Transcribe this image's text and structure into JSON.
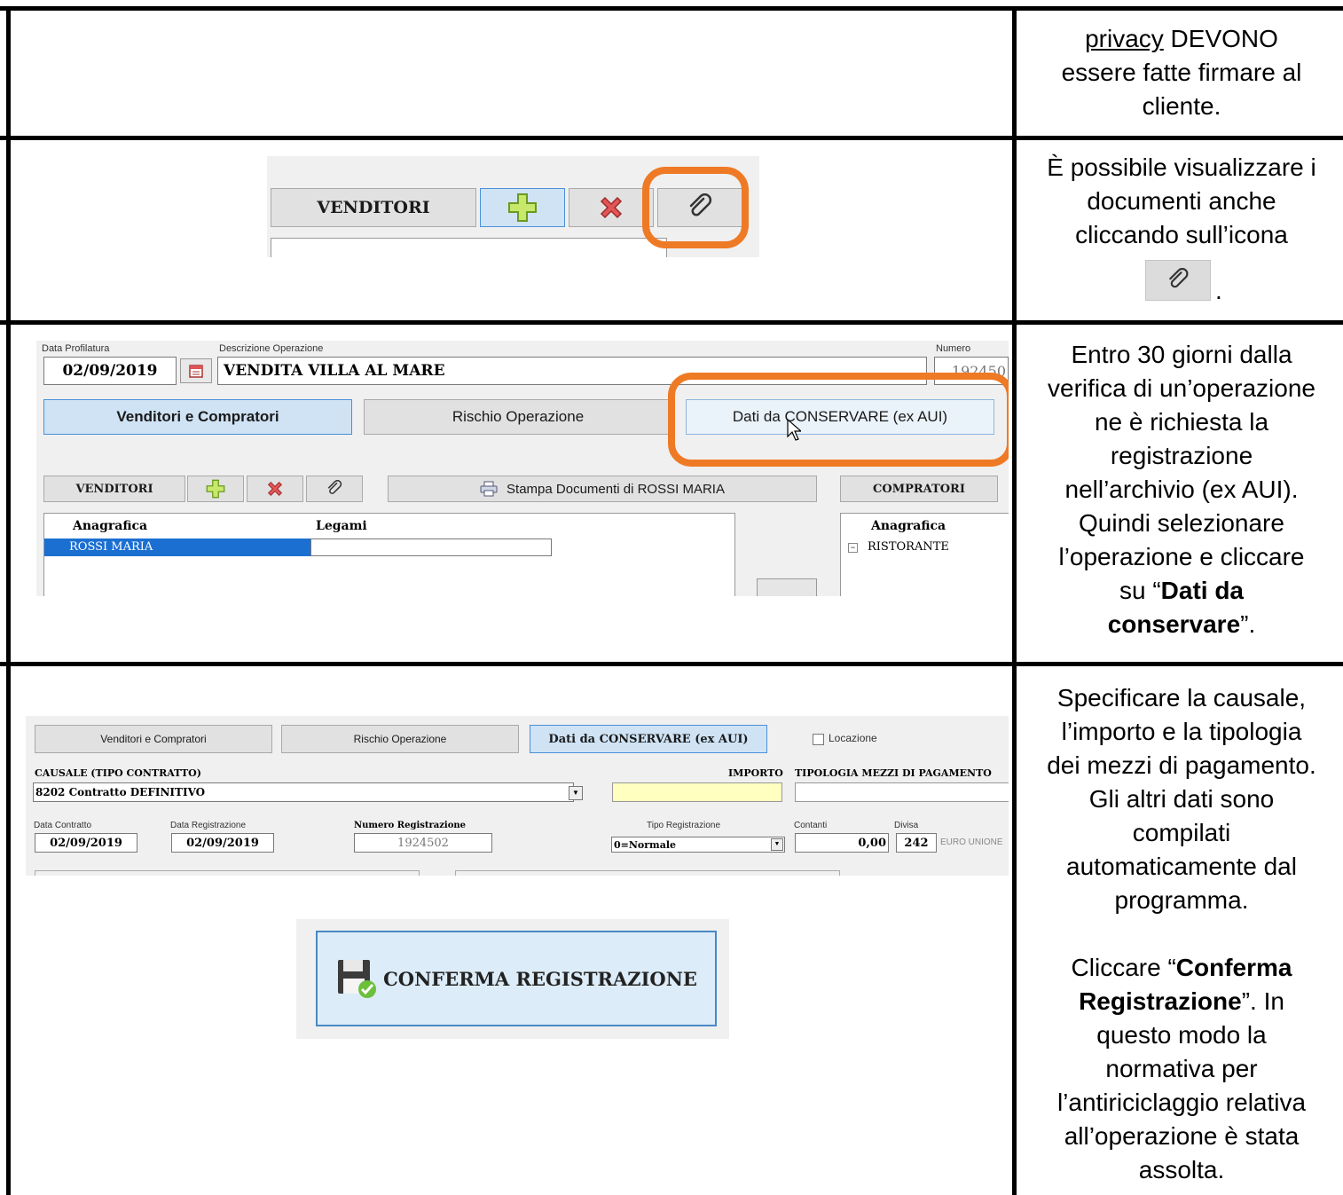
{
  "row1": {
    "link": "privacy",
    "text1": " DEVONO",
    "text2": "essere fatte firmare al",
    "text3": "cliente."
  },
  "row2": {
    "shot": {
      "venditori": "VENDITORI"
    },
    "text1": "È possibile visualizzare i",
    "text2": "documenti anche",
    "text3": "cliccando sull’icona",
    "dot": "."
  },
  "row3": {
    "shot": {
      "data_profilatura_label": "Data Profilatura",
      "data_profilatura": "02/09/2019",
      "descrizione_label": "Descrizione Operazione",
      "descrizione": "VENDITA VILLA AL MARE",
      "numero_label": "Numero",
      "numero": "192450",
      "tab_venditori": "Venditori e Compratori",
      "tab_rischio": "Rischio Operazione",
      "tab_dati": "Dati da CONSERVARE (ex AUI)",
      "venditori": "VENDITORI",
      "stampa": "Stampa Documenti di ROSSI MARIA",
      "compratori": "COMPRATORI",
      "col_anagrafica": "Anagrafica",
      "col_legami": "Legami",
      "row_venditore": "ROSSI MARIA",
      "col_anagrafica2": "Anagrafica",
      "row_compratore": "RISTORANTE"
    },
    "lines": [
      "Entro 30 giorni dalla",
      "verifica di un’operazione",
      "ne è richiesta la",
      "registrazione",
      "nell’archivio (ex AUI).",
      "Quindi selezionare",
      "l’operazione e cliccare"
    ],
    "line8_pre": "su “",
    "line8_bold": "Dati da",
    "line9_bold": "conservare",
    "line9_post": "”."
  },
  "row4": {
    "shot": {
      "tab_venditori": "Venditori e Compratori",
      "tab_rischio": "Rischio Operazione",
      "tab_dati": "Dati da CONSERVARE (ex AUI)",
      "locazione": "Locazione",
      "causale_label": "CAUSALE (TIPO CONTRATTO)",
      "causale": "8202 Contratto DEFINITIVO",
      "importo_label": "IMPORTO",
      "tipologia_label": "TIPOLOGIA MEZZI DI PAGAMENTO",
      "data_contratto_label": "Data Contratto",
      "data_contratto": "02/09/2019",
      "data_reg_label": "Data Registrazione",
      "data_reg": "02/09/2019",
      "num_reg_label": "Numero Registrazione",
      "num_reg": "1924502",
      "tipo_reg_label": "Tipo Registrazione",
      "tipo_reg": "0=Normale",
      "contanti_label": "Contanti",
      "contanti": "0,00",
      "divisa_label": "Divisa",
      "divisa": "242",
      "divisa_desc": "EURO UNIONE",
      "conferma": "CONFERMA REGISTRAZIONE"
    },
    "lines_a": [
      "Specificare la causale,",
      "l’importo e la tipologia",
      "dei mezzi di pagamento.",
      "Gli altri dati sono",
      "compilati",
      "automaticamente dal",
      "programma."
    ],
    "clk_pre": "Cliccare “",
    "clk_bold1": "Conferma",
    "clk_bold2": "Registrazione",
    "clk_post": "”. In",
    "lines_b": [
      "questo modo la",
      "normativa per",
      "l’antiriciclaggio relativa",
      "all’operazione è stata",
      "assolta."
    ]
  }
}
